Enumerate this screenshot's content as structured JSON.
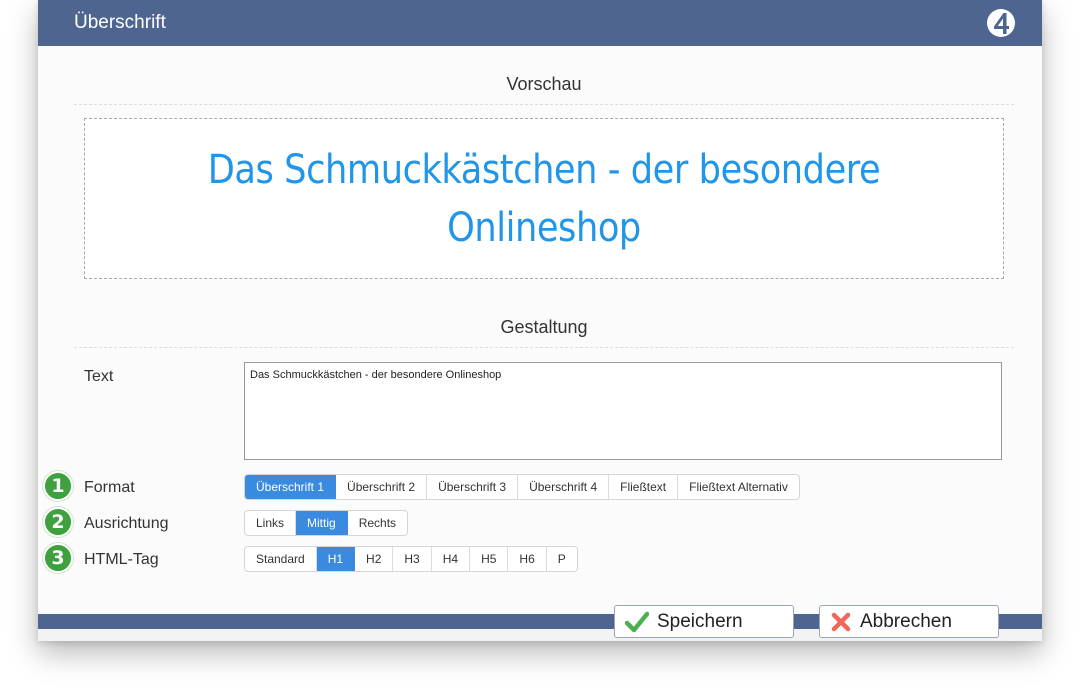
{
  "window": {
    "title": "Überschrift",
    "logo_icon": "circle-4-logo-icon"
  },
  "preview": {
    "heading": "Vorschau",
    "text": "Das Schmuckkästchen - der besondere Onlineshop",
    "color": "#2196e8"
  },
  "design": {
    "heading": "Gestaltung",
    "text_label": "Text",
    "text_value": "Das Schmuckkästchen - der besondere Onlineshop",
    "format": {
      "marker": "1",
      "label": "Format",
      "options": [
        "Überschrift 1",
        "Überschrift 2",
        "Überschrift 3",
        "Überschrift 4",
        "Fließtext",
        "Fließtext Alternativ"
      ],
      "selected": "Überschrift 1"
    },
    "alignment": {
      "marker": "2",
      "label": "Ausrichtung",
      "options": [
        "Links",
        "Mittig",
        "Rechts"
      ],
      "selected": "Mittig"
    },
    "html_tag": {
      "marker": "3",
      "label": "HTML-Tag",
      "options": [
        "Standard",
        "H1",
        "H2",
        "H3",
        "H4",
        "H5",
        "H6",
        "P"
      ],
      "selected": "H1"
    }
  },
  "footer": {
    "save_label": "Speichern",
    "save_icon": "checkmark-icon",
    "cancel_label": "Abbrechen",
    "cancel_icon": "cross-icon"
  },
  "colors": {
    "titlebar": "#4e6590",
    "active_segment": "#3a8be0",
    "marker_green": "#3fa03f",
    "save_green": "#4caf50",
    "cancel_red": "#f0685a"
  }
}
